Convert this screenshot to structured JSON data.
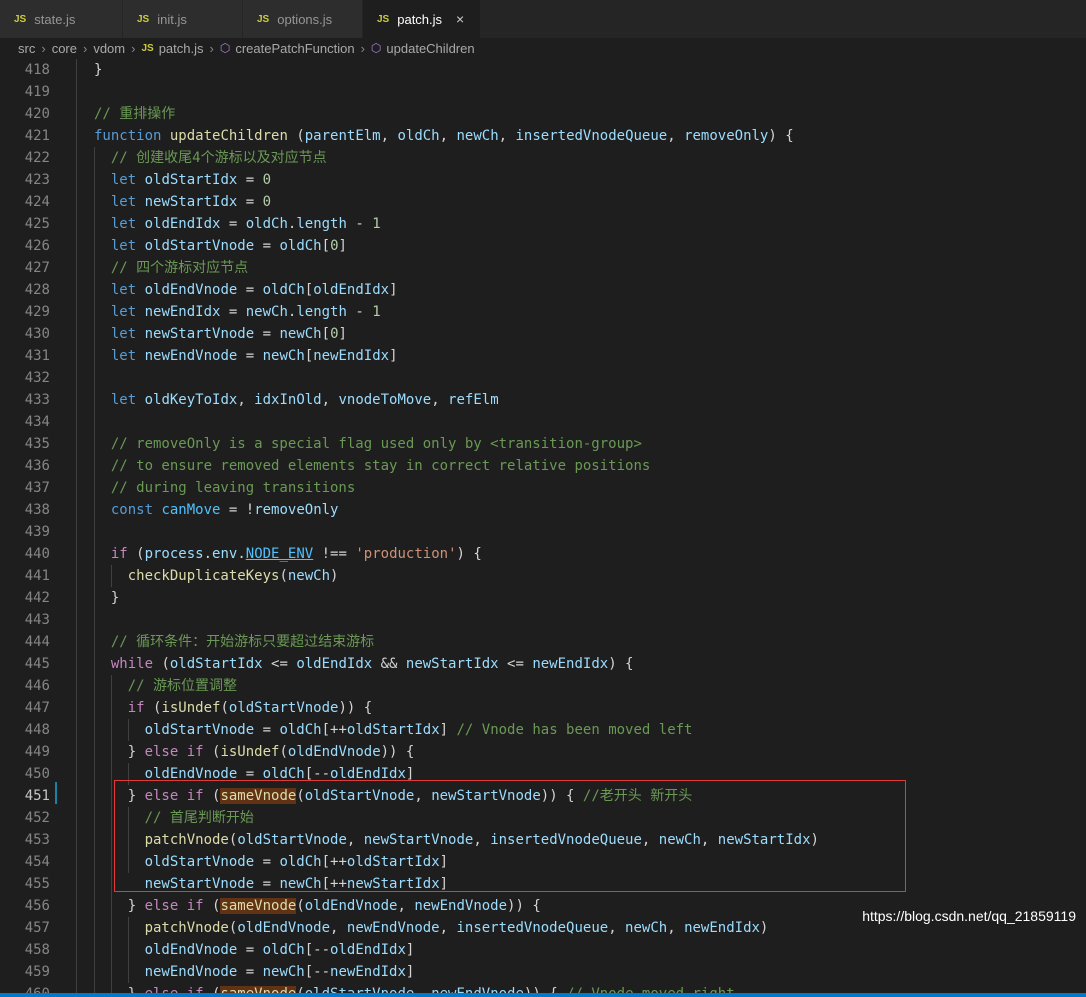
{
  "tabs": [
    {
      "badge": "JS",
      "label": "state.js",
      "active": false
    },
    {
      "badge": "JS",
      "label": "init.js",
      "active": false
    },
    {
      "badge": "JS",
      "label": "options.js",
      "active": false
    },
    {
      "badge": "JS",
      "label": "patch.js",
      "active": true,
      "close": "×"
    }
  ],
  "breadcrumb": {
    "parts": [
      "src",
      "core",
      "vdom"
    ],
    "file_badge": "JS",
    "file": "patch.js",
    "symbols": [
      "createPatchFunction",
      "updateChildren"
    ]
  },
  "editor": {
    "current_line": 451,
    "lines": [
      {
        "n": "418",
        "t": "}"
      },
      {
        "n": "419",
        "t": ""
      },
      {
        "n": "420",
        "t": "// 重排操作"
      },
      {
        "n": "421",
        "t": "function updateChildren (parentElm, oldCh, newCh, insertedVnodeQueue, removeOnly) {"
      },
      {
        "n": "422",
        "t": "  // 创建收尾4个游标以及对应节点"
      },
      {
        "n": "423",
        "t": "  let oldStartIdx = 0"
      },
      {
        "n": "424",
        "t": "  let newStartIdx = 0"
      },
      {
        "n": "425",
        "t": "  let oldEndIdx = oldCh.length - 1"
      },
      {
        "n": "426",
        "t": "  let oldStartVnode = oldCh[0]"
      },
      {
        "n": "427",
        "t": "  // 四个游标对应节点"
      },
      {
        "n": "428",
        "t": "  let oldEndVnode = oldCh[oldEndIdx]"
      },
      {
        "n": "429",
        "t": "  let newEndIdx = newCh.length - 1"
      },
      {
        "n": "430",
        "t": "  let newStartVnode = newCh[0]"
      },
      {
        "n": "431",
        "t": "  let newEndVnode = newCh[newEndIdx]"
      },
      {
        "n": "432",
        "t": ""
      },
      {
        "n": "433",
        "t": "  let oldKeyToIdx, idxInOld, vnodeToMove, refElm"
      },
      {
        "n": "434",
        "t": ""
      },
      {
        "n": "435",
        "t": "  // removeOnly is a special flag used only by <transition-group>"
      },
      {
        "n": "436",
        "t": "  // to ensure removed elements stay in correct relative positions"
      },
      {
        "n": "437",
        "t": "  // during leaving transitions"
      },
      {
        "n": "438",
        "t": "  const canMove = !removeOnly"
      },
      {
        "n": "439",
        "t": ""
      },
      {
        "n": "440",
        "t": "  if (process.env.NODE_ENV !== 'production') {"
      },
      {
        "n": "441",
        "t": "    checkDuplicateKeys(newCh)"
      },
      {
        "n": "442",
        "t": "  }"
      },
      {
        "n": "443",
        "t": ""
      },
      {
        "n": "444",
        "t": "  // 循环条件：开始游标只要超过结束游标"
      },
      {
        "n": "445",
        "t": "  while (oldStartIdx <= oldEndIdx && newStartIdx <= newEndIdx) {"
      },
      {
        "n": "446",
        "t": "    // 游标位置调整"
      },
      {
        "n": "447",
        "t": "    if (isUndef(oldStartVnode)) {"
      },
      {
        "n": "448",
        "t": "      oldStartVnode = oldCh[++oldStartIdx] // Vnode has been moved left"
      },
      {
        "n": "449",
        "t": "    } else if (isUndef(oldEndVnode)) {"
      },
      {
        "n": "450",
        "t": "      oldEndVnode = oldCh[--oldEndIdx]"
      },
      {
        "n": "451",
        "t": "    } else if (sameVnode(oldStartVnode, newStartVnode)) { //老开头 新开头"
      },
      {
        "n": "452",
        "t": "      // 首尾判断开始"
      },
      {
        "n": "453",
        "t": "      patchVnode(oldStartVnode, newStartVnode, insertedVnodeQueue, newCh, newStartIdx)"
      },
      {
        "n": "454",
        "t": "      oldStartVnode = oldCh[++oldStartIdx]"
      },
      {
        "n": "455",
        "t": "      newStartVnode = newCh[++newStartIdx]"
      },
      {
        "n": "456",
        "t": "    } else if (sameVnode(oldEndVnode, newEndVnode)) {"
      },
      {
        "n": "457",
        "t": "      patchVnode(oldEndVnode, newEndVnode, insertedVnodeQueue, newCh, newEndIdx)"
      },
      {
        "n": "458",
        "t": "      oldEndVnode = oldCh[--oldEndIdx]"
      },
      {
        "n": "459",
        "t": "      newEndVnode = newCh[--newEndIdx]"
      },
      {
        "n": "460",
        "t": "    } else if (sameVnode(oldStartVnode, newEndVnode)) { // Vnode moved right"
      }
    ]
  },
  "watermark": "https://blog.csdn.net/qq_21859119",
  "colors": {
    "background": "#1e1e1e",
    "highlight_box": "#e03a3a",
    "keyword": "#569cd6",
    "comment": "#6a9955",
    "function": "#dcdcaa",
    "variable": "#9cdcfe"
  }
}
